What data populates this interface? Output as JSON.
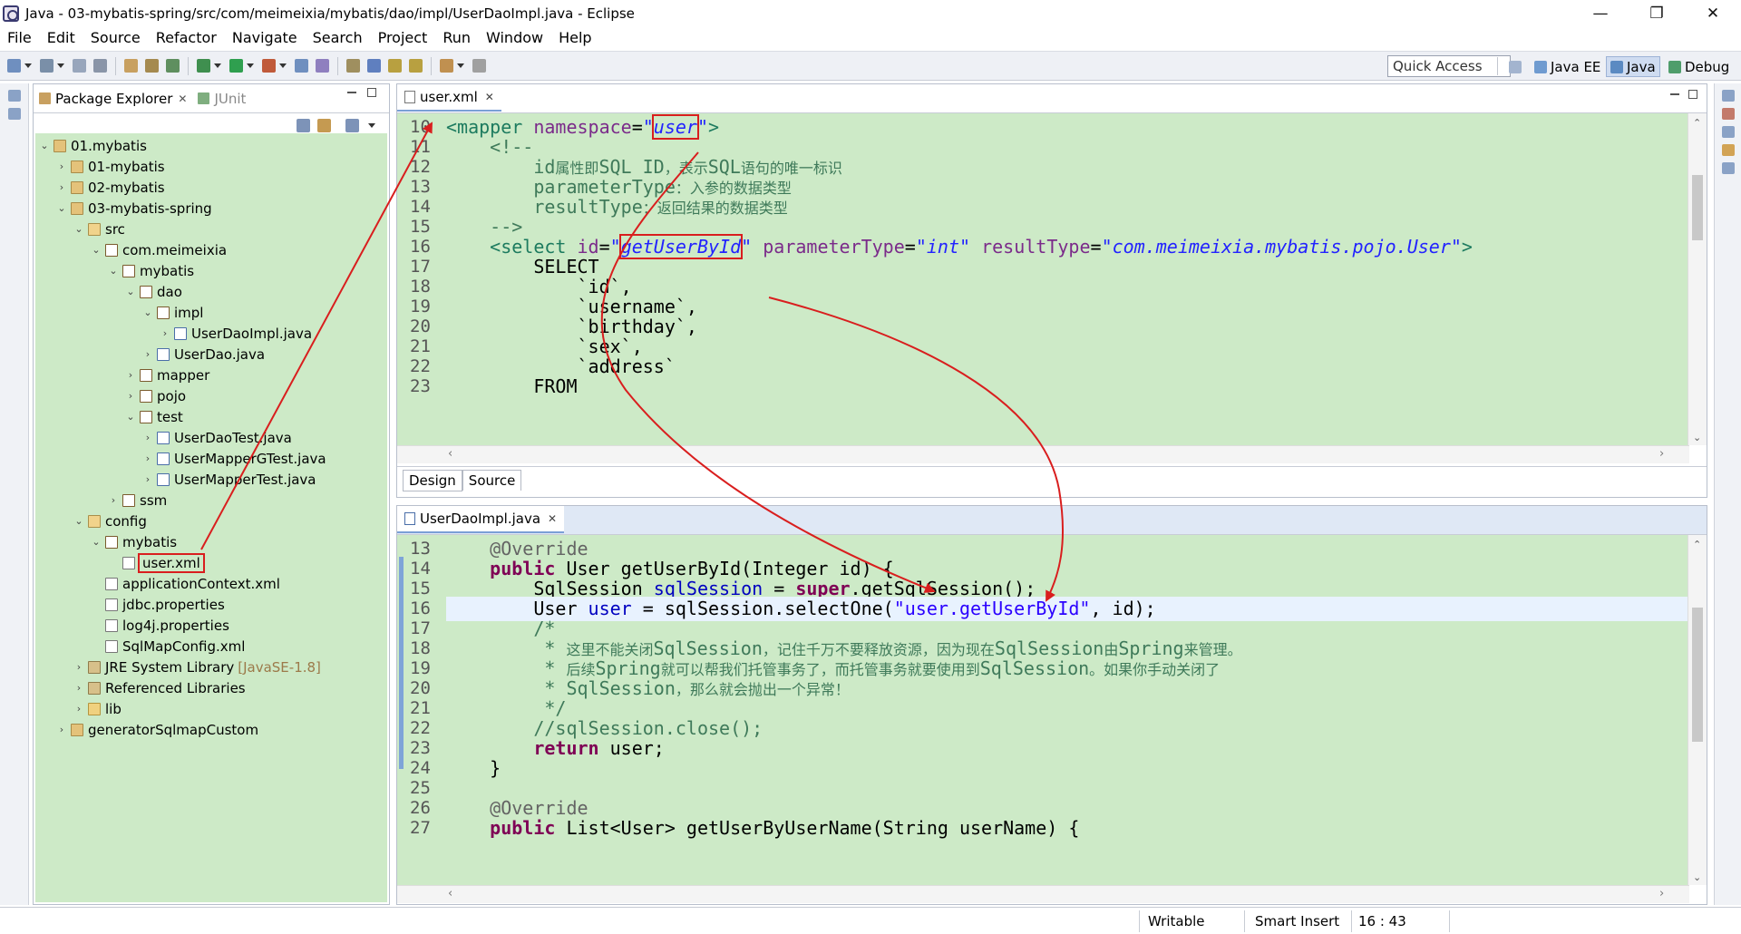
{
  "window": {
    "title": "Java - 03-mybatis-spring/src/com/meimeixia/mybatis/dao/impl/UserDaoImpl.java - Eclipse",
    "minimize_glyph": "—",
    "restore_glyph": "❐",
    "close_glyph": "✕"
  },
  "menu": [
    "File",
    "Edit",
    "Source",
    "Refactor",
    "Navigate",
    "Search",
    "Project",
    "Run",
    "Window",
    "Help"
  ],
  "toolbar": {
    "quick_access": "Quick Access",
    "perspectives": [
      {
        "label": "Java EE"
      },
      {
        "label": "Java"
      },
      {
        "label": "Debug"
      }
    ]
  },
  "package_explorer": {
    "tab_label": "Package Explorer",
    "junit_label": "JUnit",
    "close_glyph": "✕",
    "tree": [
      {
        "label": "01.mybatis",
        "expanded": true,
        "level": 0,
        "icon": "proj"
      },
      {
        "label": "01-mybatis",
        "level": 1,
        "icon": "proj"
      },
      {
        "label": "02-mybatis",
        "level": 1,
        "icon": "proj"
      },
      {
        "label": "03-mybatis-spring",
        "expanded": true,
        "level": 1,
        "icon": "proj"
      },
      {
        "label": "src",
        "expanded": true,
        "level": 2,
        "icon": "src"
      },
      {
        "label": "com.meimeixia",
        "expanded": true,
        "level": 3,
        "icon": "pkg"
      },
      {
        "label": "mybatis",
        "expanded": true,
        "level": 4,
        "icon": "pkg"
      },
      {
        "label": "dao",
        "expanded": true,
        "level": 5,
        "icon": "pkg"
      },
      {
        "label": "impl",
        "expanded": true,
        "level": 6,
        "icon": "pkg"
      },
      {
        "label": "UserDaoImpl.java",
        "level": 7,
        "icon": "java"
      },
      {
        "label": "UserDao.java",
        "level": 6,
        "icon": "java"
      },
      {
        "label": "mapper",
        "level": 5,
        "icon": "pkg"
      },
      {
        "label": "pojo",
        "level": 5,
        "icon": "pkg"
      },
      {
        "label": "test",
        "expanded": true,
        "level": 5,
        "icon": "pkg"
      },
      {
        "label": "UserDaoTest.java",
        "level": 6,
        "icon": "java"
      },
      {
        "label": "UserMapperGTest.java",
        "level": 6,
        "icon": "java"
      },
      {
        "label": "UserMapperTest.java",
        "level": 6,
        "icon": "java"
      },
      {
        "label": "ssm",
        "level": 4,
        "icon": "pkg"
      },
      {
        "label": "config",
        "expanded": true,
        "level": 2,
        "icon": "src"
      },
      {
        "label": "mybatis",
        "expanded": true,
        "level": 3,
        "icon": "pkg"
      },
      {
        "label": "user.xml",
        "level": 4,
        "icon": "xml",
        "leaf": true,
        "highlight": true
      },
      {
        "label": "applicationContext.xml",
        "level": 3,
        "icon": "xml",
        "leaf": true
      },
      {
        "label": "jdbc.properties",
        "level": 3,
        "icon": "xml",
        "leaf": true
      },
      {
        "label": "log4j.properties",
        "level": 3,
        "icon": "xml",
        "leaf": true
      },
      {
        "label": "SqlMapConfig.xml",
        "level": 3,
        "icon": "xml",
        "leaf": true
      },
      {
        "label": "JRE System Library",
        "suffix": "[JavaSE-1.8]",
        "level": 2,
        "icon": "lib"
      },
      {
        "label": "Referenced Libraries",
        "level": 2,
        "icon": "lib"
      },
      {
        "label": "lib",
        "level": 2,
        "icon": "folder"
      },
      {
        "label": "generatorSqlmapCustom",
        "level": 1,
        "icon": "proj"
      }
    ]
  },
  "xml_editor": {
    "tab_label": "user.xml",
    "close_glyph": "✕",
    "lines": [
      {
        "num": "10",
        "segments": [
          [
            "t-tag",
            "<mapper "
          ],
          [
            "t-attr",
            "namespace"
          ],
          [
            "",
            "="
          ],
          [
            "t-str",
            "\""
          ],
          [
            "t-str hl-box",
            "user"
          ],
          [
            "t-str",
            "\""
          ],
          [
            "t-tag",
            ">"
          ]
        ]
      },
      {
        "num": "11",
        "segments": [
          [
            "t-cmt",
            "    <!--"
          ]
        ]
      },
      {
        "num": "12",
        "segments": [
          [
            "t-cmt",
            "        id"
          ],
          [
            "t-cmt zh",
            "属性即"
          ],
          [
            "t-cmt",
            "SQL ID"
          ],
          [
            "t-cmt zh",
            "，表示"
          ],
          [
            "t-cmt",
            "SQL"
          ],
          [
            "t-cmt zh",
            "语句的唯一标识"
          ]
        ]
      },
      {
        "num": "13",
        "segments": [
          [
            "t-cmt",
            "        parameterType"
          ],
          [
            "t-cmt zh",
            "：入参的数据类型"
          ]
        ]
      },
      {
        "num": "14",
        "segments": [
          [
            "t-cmt",
            "        resultType"
          ],
          [
            "t-cmt zh",
            "：返回结果的数据类型"
          ]
        ]
      },
      {
        "num": "15",
        "segments": [
          [
            "t-cmt",
            "    -->"
          ]
        ]
      },
      {
        "num": "16",
        "segments": [
          [
            "t-tag",
            "    <select "
          ],
          [
            "t-attr",
            "id"
          ],
          [
            "",
            "="
          ],
          [
            "t-str",
            "\""
          ],
          [
            "t-str hl-box",
            "getUserById"
          ],
          [
            "t-str",
            "\""
          ],
          [
            "",
            " "
          ],
          [
            "t-attr",
            "parameterType"
          ],
          [
            "",
            "="
          ],
          [
            "t-str",
            "\"int\""
          ],
          [
            "",
            " "
          ],
          [
            "t-attr",
            "resultType"
          ],
          [
            "",
            "="
          ],
          [
            "t-str",
            "\"com.meimeixia.mybatis.pojo.User\""
          ],
          [
            "t-tag",
            ">"
          ]
        ]
      },
      {
        "num": "17",
        "segments": [
          [
            "",
            "        SELECT"
          ]
        ]
      },
      {
        "num": "18",
        "segments": [
          [
            "",
            "            `id`,"
          ]
        ]
      },
      {
        "num": "19",
        "segments": [
          [
            "",
            "            `username`,"
          ]
        ]
      },
      {
        "num": "20",
        "segments": [
          [
            "",
            "            `birthday`,"
          ]
        ]
      },
      {
        "num": "21",
        "segments": [
          [
            "",
            "            `sex`,"
          ]
        ]
      },
      {
        "num": "22",
        "segments": [
          [
            "",
            "            `address`"
          ]
        ]
      },
      {
        "num": "23",
        "segments": [
          [
            "",
            "        FROM"
          ]
        ]
      }
    ],
    "design_tab": "Design",
    "source_tab": "Source"
  },
  "java_editor": {
    "tab_label": "UserDaoImpl.java",
    "close_glyph": "✕",
    "lines": [
      {
        "num": "13",
        "segments": [
          [
            "t-ann",
            "    @Override"
          ]
        ]
      },
      {
        "num": "14",
        "segments": [
          [
            "t-kw",
            "    public"
          ],
          [
            "",
            " User getUserById(Integer id) {"
          ]
        ]
      },
      {
        "num": "15",
        "segments": [
          [
            "",
            "        SqlSession "
          ],
          [
            "t-field",
            "sqlSession"
          ],
          [
            "",
            " = "
          ],
          [
            "t-kw",
            "super"
          ],
          [
            "",
            ".getSqlSession();"
          ]
        ]
      },
      {
        "num": "16",
        "current": true,
        "segments": [
          [
            "",
            "        User "
          ],
          [
            "t-field",
            "user"
          ],
          [
            "",
            " = sqlSession.selectOne("
          ],
          [
            "t-jstr",
            "\"user.getUserById\""
          ],
          [
            "",
            ", id);"
          ]
        ]
      },
      {
        "num": "17",
        "segments": [
          [
            "t-cmt",
            "        /*"
          ]
        ]
      },
      {
        "num": "18",
        "segments": [
          [
            "t-cmt",
            "         * "
          ],
          [
            "t-cmt zh",
            "这里不能关闭"
          ],
          [
            "t-cmt",
            "SqlSession"
          ],
          [
            "t-cmt zh",
            "，记住千万不要释放资源，因为现在"
          ],
          [
            "t-cmt",
            "SqlSession"
          ],
          [
            "t-cmt zh",
            "由"
          ],
          [
            "t-cmt",
            "Spring"
          ],
          [
            "t-cmt zh",
            "来管理。"
          ]
        ]
      },
      {
        "num": "19",
        "segments": [
          [
            "t-cmt",
            "         * "
          ],
          [
            "t-cmt zh",
            "后续"
          ],
          [
            "t-cmt",
            "Spring"
          ],
          [
            "t-cmt zh",
            "就可以帮我们托管事务了，而托管事务就要使用到"
          ],
          [
            "t-cmt",
            "SqlSession"
          ],
          [
            "t-cmt zh",
            "。如果你手动关闭了"
          ]
        ]
      },
      {
        "num": "20",
        "segments": [
          [
            "t-cmt",
            "         * SqlSession"
          ],
          [
            "t-cmt zh",
            "，那么就会抛出一个异常！"
          ]
        ]
      },
      {
        "num": "21",
        "segments": [
          [
            "t-cmt",
            "         */"
          ]
        ]
      },
      {
        "num": "22",
        "segments": [
          [
            "t-cmt",
            "        //sqlSession.close();"
          ]
        ]
      },
      {
        "num": "23",
        "segments": [
          [
            "t-kw",
            "        return"
          ],
          [
            "",
            " user;"
          ]
        ]
      },
      {
        "num": "24",
        "segments": [
          [
            "",
            "    }"
          ]
        ]
      },
      {
        "num": "25",
        "segments": [
          [
            "",
            ""
          ]
        ]
      },
      {
        "num": "26",
        "segments": [
          [
            "t-ann",
            "    @Override"
          ]
        ]
      },
      {
        "num": "27",
        "segments": [
          [
            "t-kw",
            "    public"
          ],
          [
            "",
            " List<User> getUserByUserName(String userName) {"
          ]
        ]
      }
    ]
  },
  "status": {
    "writable": "Writable",
    "insert_mode": "Smart Insert",
    "position": "16 : 43"
  },
  "colors": {
    "annotation_red": "#d91e1e",
    "editor_background": "#cdeac7",
    "current_line": "#e8f2fe"
  }
}
